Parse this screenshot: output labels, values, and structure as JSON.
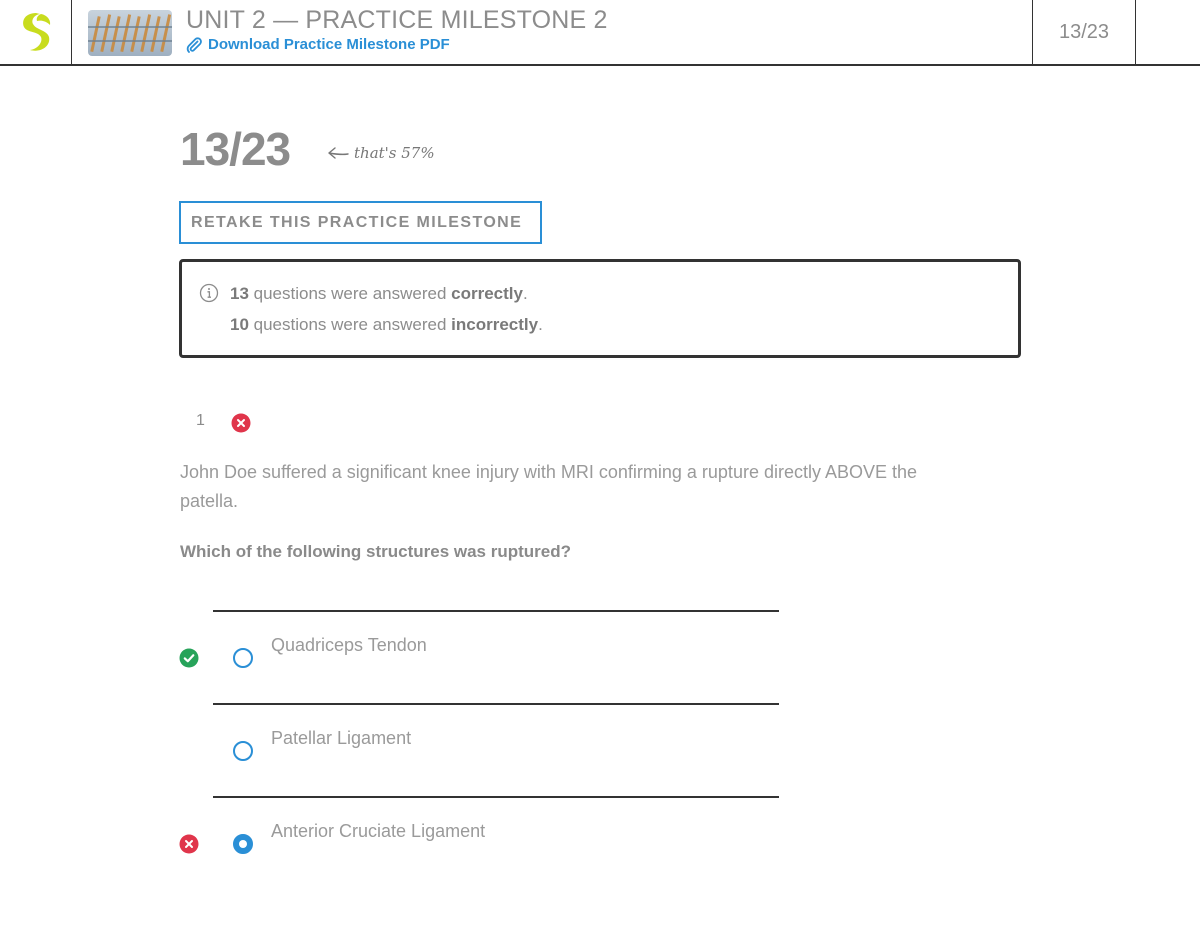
{
  "header": {
    "unit_title": "UNIT 2 — PRACTICE MILESTONE 2",
    "pdf_link": "Download Practice Milestone PDF",
    "score": "13/23"
  },
  "result": {
    "score": "13/23",
    "note": "that's 57%",
    "percent": 57,
    "retake_label": "RETAKE THIS PRACTICE MILESTONE"
  },
  "summary": {
    "correct_count": "13",
    "correct_text": " questions were answered ",
    "correct_word": "correctly",
    "incorrect_count": "10",
    "incorrect_text": " questions were answered ",
    "incorrect_word": "incorrectly",
    "period": "."
  },
  "question": {
    "number": "1",
    "status": "incorrect",
    "text": "John Doe suffered a significant knee injury with MRI confirming a rupture directly ABOVE the patella.",
    "prompt": "Which of the following structures was ruptured?",
    "answers": [
      {
        "label": "Quadriceps Tendon",
        "correct": true,
        "selected": false
      },
      {
        "label": "Patellar Ligament",
        "correct": false,
        "selected": false
      },
      {
        "label": "Anterior Cruciate Ligament",
        "correct": false,
        "selected": true
      }
    ]
  },
  "colors": {
    "accent": "#2a8fd6",
    "correct": "#27a35a",
    "incorrect": "#e0354b",
    "logo": "#c8dc1e"
  }
}
